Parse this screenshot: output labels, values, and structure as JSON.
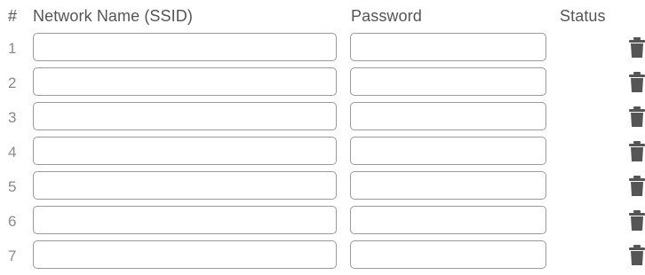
{
  "header": {
    "num": "#",
    "ssid": "Network Name (SSID)",
    "password": "Password",
    "status": "Status"
  },
  "rows": [
    {
      "num": "1",
      "ssid": "",
      "password": "",
      "status": ""
    },
    {
      "num": "2",
      "ssid": "",
      "password": "",
      "status": ""
    },
    {
      "num": "3",
      "ssid": "",
      "password": "",
      "status": ""
    },
    {
      "num": "4",
      "ssid": "",
      "password": "",
      "status": ""
    },
    {
      "num": "5",
      "ssid": "",
      "password": "",
      "status": ""
    },
    {
      "num": "6",
      "ssid": "",
      "password": "",
      "status": ""
    },
    {
      "num": "7",
      "ssid": "",
      "password": "",
      "status": ""
    }
  ],
  "icons": {
    "delete": "trash-icon"
  },
  "colors": {
    "text": "#555555",
    "row_number": "#8a8a8a",
    "input_border": "#9a9a9a",
    "icon": "#555555"
  }
}
